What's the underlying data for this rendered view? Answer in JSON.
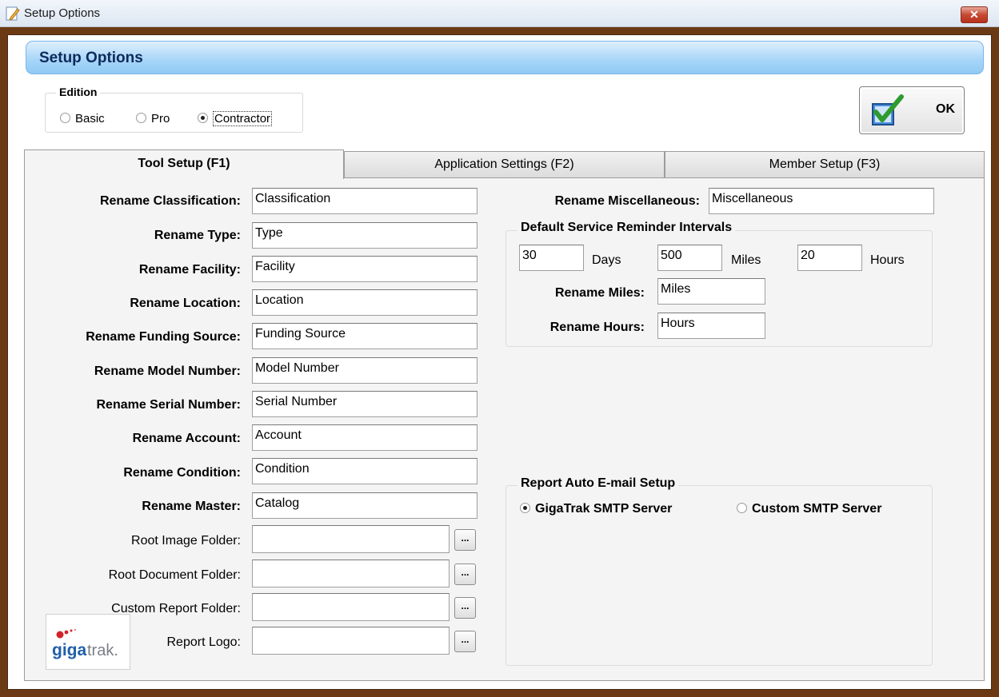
{
  "window": {
    "title": "Setup Options",
    "close_glyph": "✕"
  },
  "header": {
    "title": "Setup Options"
  },
  "edition": {
    "legend": "Edition",
    "options": [
      "Basic",
      "Pro",
      "Contractor"
    ],
    "selected": "Contractor"
  },
  "ok_button": {
    "label": "OK"
  },
  "tabs": [
    {
      "label": "Tool Setup (F1)",
      "active": true
    },
    {
      "label": "Application Settings (F2)",
      "active": false
    },
    {
      "label": "Member Setup (F3)",
      "active": false
    }
  ],
  "tool_setup": {
    "rename_fields": [
      {
        "label": "Rename Classification:",
        "value": "Classification"
      },
      {
        "label": "Rename Type:",
        "value": "Type"
      },
      {
        "label": "Rename Facility:",
        "value": "Facility"
      },
      {
        "label": "Rename Location:",
        "value": "Location"
      },
      {
        "label": "Rename Funding Source:",
        "value": "Funding Source"
      },
      {
        "label": "Rename Model Number:",
        "value": "Model Number"
      },
      {
        "label": "Rename Serial Number:",
        "value": "Serial Number"
      },
      {
        "label": "Rename Account:",
        "value": "Account"
      },
      {
        "label": "Rename Condition:",
        "value": "Condition"
      },
      {
        "label": "Rename Master:",
        "value": "Catalog"
      }
    ],
    "folder_fields": [
      {
        "label": "Root Image Folder:",
        "value": ""
      },
      {
        "label": "Root Document Folder:",
        "value": ""
      },
      {
        "label": "Custom Report Folder:",
        "value": ""
      },
      {
        "label": "Report Logo:",
        "value": ""
      }
    ],
    "browse_label": "...",
    "logo_text": {
      "giga": "giga",
      "trak": "trak."
    },
    "rename_miscellaneous": {
      "label": "Rename Miscellaneous:",
      "value": "Miscellaneous"
    },
    "service_intervals": {
      "legend": "Default Service Reminder Intervals",
      "days": {
        "value": "30",
        "unit": "Days"
      },
      "miles": {
        "value": "500",
        "unit": "Miles"
      },
      "hours": {
        "value": "20",
        "unit": "Hours"
      },
      "rename_miles": {
        "label": "Rename Miles:",
        "value": "Miles"
      },
      "rename_hours": {
        "label": "Rename Hours:",
        "value": "Hours"
      }
    },
    "email_setup": {
      "legend": "Report Auto E-mail Setup",
      "options": [
        "GigaTrak SMTP Server",
        "Custom SMTP Server"
      ],
      "selected": "GigaTrak SMTP Server"
    }
  },
  "colors": {
    "header_gradient_top": "#dff0fd",
    "header_gradient_bottom": "#8fcaf5",
    "window_frame": "#6b3a14",
    "panel_bg": "#f4f4f4",
    "logo_red": "#d2232a",
    "logo_blue": "#1f5fa8"
  }
}
